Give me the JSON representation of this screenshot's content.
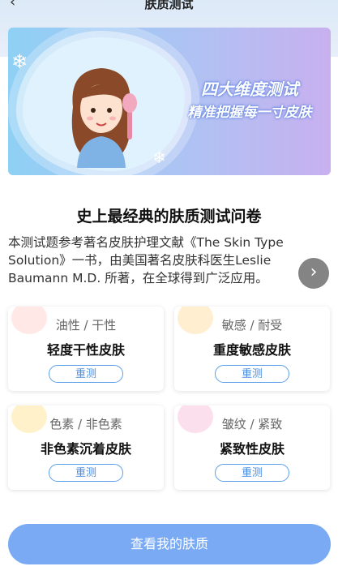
{
  "header": {
    "title": "肤质测试",
    "back_icon": "back-arrow-icon"
  },
  "banner": {
    "line1": "四大维度测试",
    "line2": "精准把握每一寸皮肤",
    "colors": {
      "from": "#8fd0f5",
      "to": "#c8b0ef"
    }
  },
  "intro": {
    "title": "史上最经典的肤质测试问卷",
    "description": "本测试题参考著名皮肤护理文献《The Skin Type Solution》一书，由美国著名皮肤科医生Leslie Baumann M.D. 所著，在全球得到广泛应用。",
    "next_icon": "chevron-right-icon"
  },
  "cards": [
    {
      "dims": "油性 / 干性",
      "result": "轻度干性皮肤",
      "button": "重测",
      "accent": "#ffd6d0"
    },
    {
      "dims": "敏感 / 耐受",
      "result": "重度敏感皮肤",
      "button": "重测",
      "accent": "#ffe0a8"
    },
    {
      "dims": "色素 / 非色素",
      "result": "非色素沉着皮肤",
      "button": "重测",
      "accent": "#ffe7a0"
    },
    {
      "dims": "皱纹 / 紧致",
      "result": "紧致性皮肤",
      "button": "重测",
      "accent": "#f7c4dd"
    }
  ],
  "footer": {
    "button": "查看我的肤质",
    "color": "#79aaf3"
  }
}
